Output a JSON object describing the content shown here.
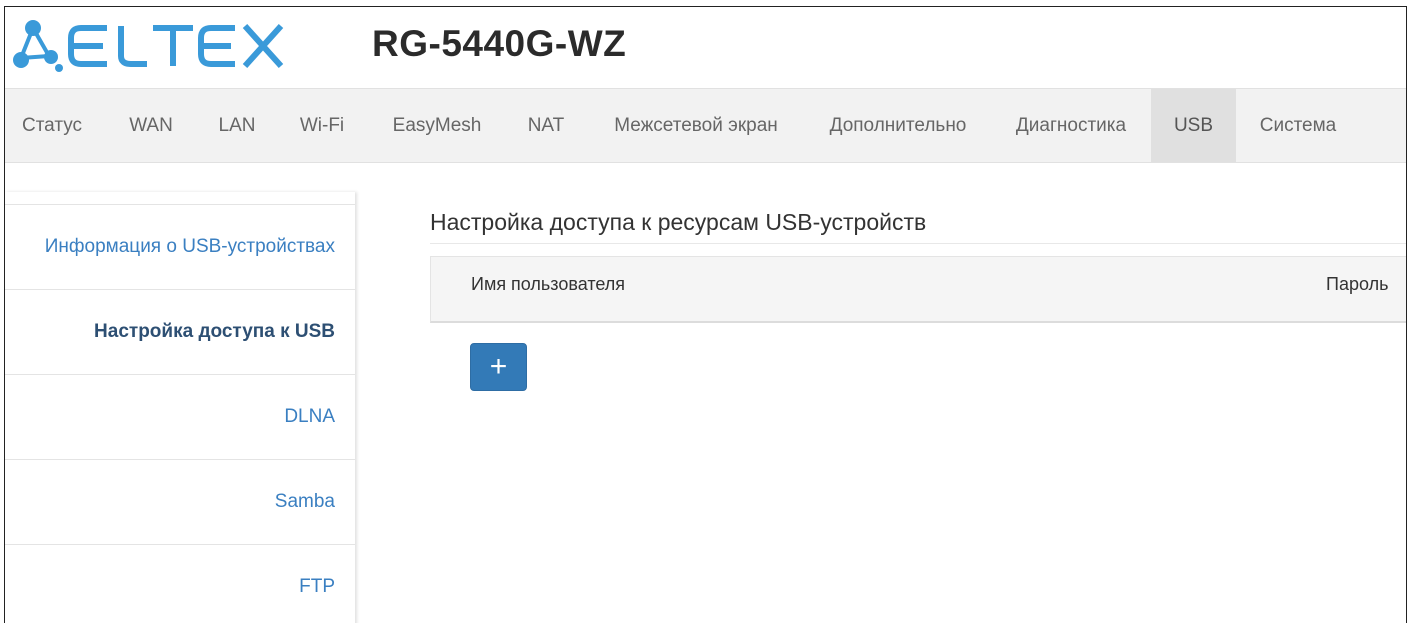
{
  "header": {
    "logo_text": "ELTEX",
    "model": "RG-5440G-WZ"
  },
  "nav": {
    "items": [
      {
        "label": "Статус"
      },
      {
        "label": "WAN"
      },
      {
        "label": "LAN"
      },
      {
        "label": "Wi-Fi"
      },
      {
        "label": "EasyMesh"
      },
      {
        "label": "NAT"
      },
      {
        "label": "Межсетевой экран"
      },
      {
        "label": "Дополнительно"
      },
      {
        "label": "Диагностика"
      },
      {
        "label": "USB"
      },
      {
        "label": "Система"
      }
    ],
    "active": "USB"
  },
  "sidebar": {
    "items": [
      {
        "label": "Информация о USB-устройствах"
      },
      {
        "label": "Настройка доступа к USB"
      },
      {
        "label": "DLNA"
      },
      {
        "label": "Samba"
      },
      {
        "label": "FTP"
      }
    ],
    "active": "Настройка доступа к USB"
  },
  "main": {
    "title": "Настройка доступа к ресурсам USB-устройств",
    "columns": [
      "Имя пользователя",
      "Пароль"
    ],
    "add_button": "+"
  },
  "colors": {
    "brand": "#3a9ad9",
    "link": "#3a7fc1",
    "button": "#337ab7"
  }
}
